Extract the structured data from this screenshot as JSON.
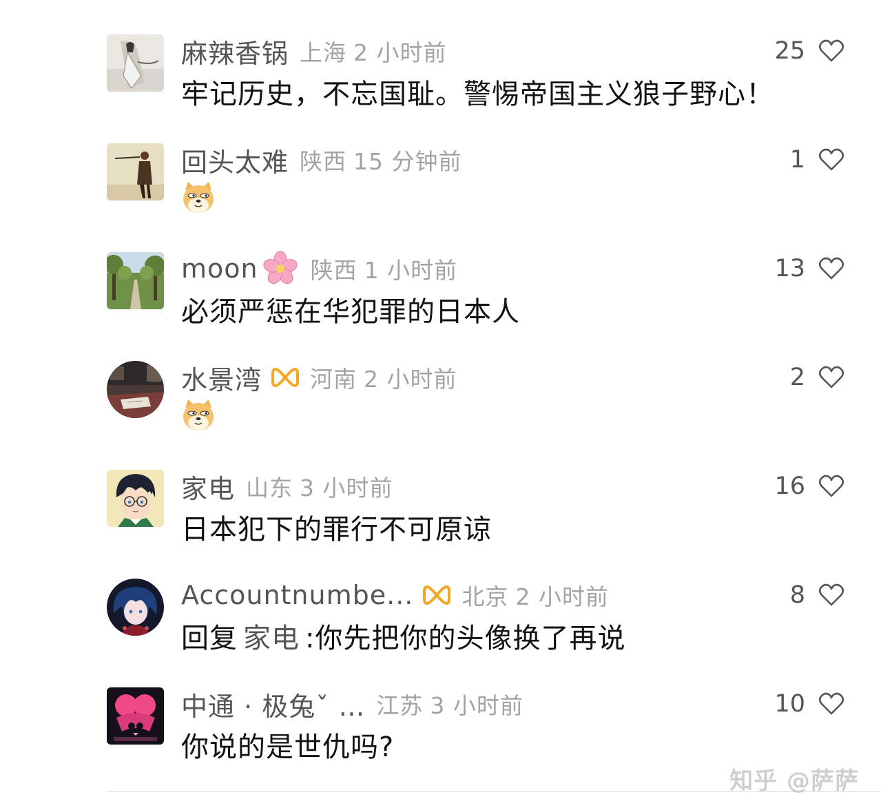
{
  "comments": [
    {
      "username": "麻辣香锅",
      "location": "上海",
      "time": "2 小时前",
      "text": "牢记历史，不忘国耻。警惕帝国主义狼子野心！",
      "likes": "25",
      "avatar": "ink-painting-figure-avatar"
    },
    {
      "username": "回头太难",
      "location": "陕西",
      "time": "15 分钟前",
      "emoji": "doge-emoji",
      "likes": "1",
      "avatar": "warrior-figure-avatar"
    },
    {
      "username": "moon",
      "location": "陕西",
      "time": "1 小时前",
      "text": "必须严惩在华犯罪的日本人",
      "likes": "13",
      "avatar": "tree-lined-path-avatar",
      "name_icon": "cherry-blossom-icon"
    },
    {
      "username": "水景湾",
      "location": "河南",
      "time": "2 小时前",
      "emoji": "doge-emoji",
      "likes": "2",
      "avatar": "desk-photo-avatar",
      "badge": "infinity-badge-icon"
    },
    {
      "username": "家电",
      "location": "山东",
      "time": "3 小时前",
      "text": "日本犯下的罪行不可原谅",
      "likes": "16",
      "avatar": "anime-boy-glasses-avatar"
    },
    {
      "username": "Accountnumbe...",
      "location": "北京",
      "time": "2 小时前",
      "reply_prefix": "回复",
      "reply_target": "家电",
      "text": ":你先把你的头像换了再说",
      "likes": "8",
      "avatar": "anime-character-avatar",
      "badge": "infinity-badge-icon"
    },
    {
      "username": "中通 · 极兔ˇ …",
      "location": "江苏",
      "time": "3 小时前",
      "text": "你说的是世仇吗?",
      "likes": "10",
      "avatar": "pink-silhouette-avatar"
    }
  ],
  "watermark": "知乎 @萨萨",
  "colors": {
    "username": "#555555",
    "meta": "#a3a3a3",
    "text": "#121212",
    "badge": "#f5a623",
    "heart_outline": "#555555"
  }
}
